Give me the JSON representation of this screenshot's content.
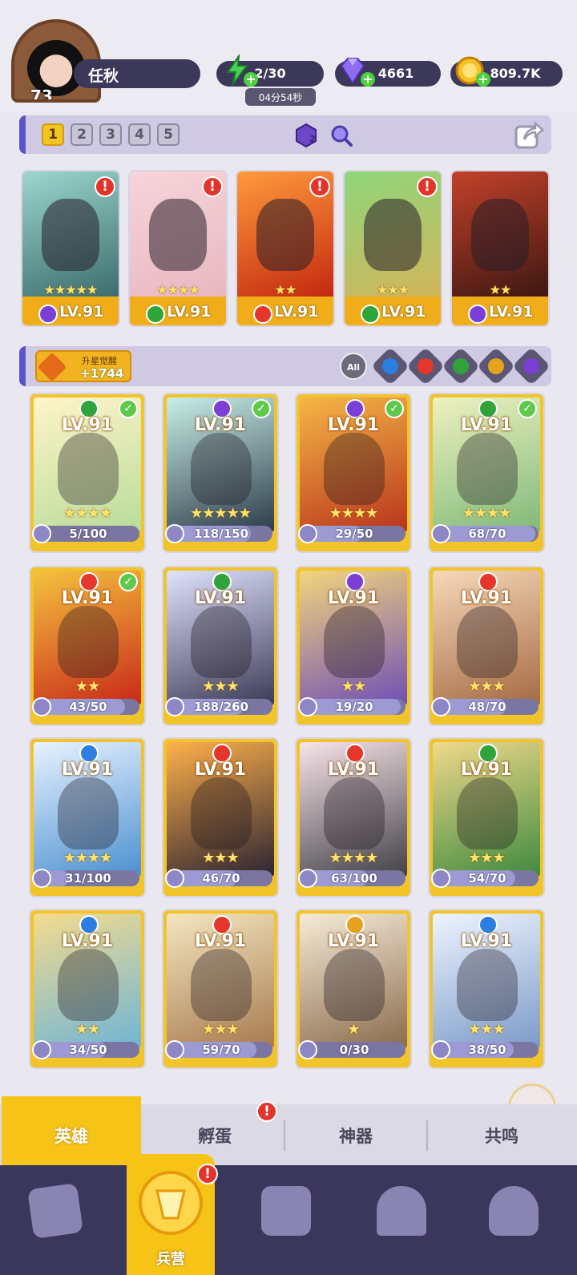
{
  "player": {
    "level": "73",
    "name": "任秋"
  },
  "resources": {
    "energy": {
      "value": "2/30",
      "timer": "04分54秒",
      "icon": "energy-icon"
    },
    "gems": {
      "value": "4661",
      "icon": "gem-icon"
    },
    "coins": {
      "value": "809.7K",
      "icon": "coin-icon"
    }
  },
  "team": {
    "tabs": [
      "1",
      "2",
      "3",
      "4",
      "5"
    ],
    "active_tab": "1",
    "badge_count": "2"
  },
  "lineup": [
    {
      "level": "LV.91",
      "stars": "★★★★★",
      "element": "dark",
      "alert": "!"
    },
    {
      "level": "LV.91",
      "stars": "★★★★",
      "element": "nature",
      "alert": "!"
    },
    {
      "level": "LV.91",
      "stars": "★★",
      "element": "fire",
      "alert": "!"
    },
    {
      "level": "LV.91",
      "stars": "★★★",
      "element": "nature",
      "alert": "!"
    },
    {
      "level": "LV.91",
      "stars": "★★",
      "element": "dark",
      "alert": ""
    }
  ],
  "awaken": {
    "label": "升星觉醒",
    "value": "+1744"
  },
  "filters": {
    "all_label": "All"
  },
  "heroes": [
    {
      "level": "LV.91",
      "stars": "★★★★",
      "shards": "5/100",
      "shard_fraction": 0.05,
      "element": "nature",
      "checked": true
    },
    {
      "level": "LV.91",
      "stars": "★★★★★",
      "shards": "118/150",
      "shard_fraction": 0.787,
      "element": "dark",
      "checked": true
    },
    {
      "level": "LV.91",
      "stars": "★★★★",
      "shards": "29/50",
      "shard_fraction": 0.58,
      "element": "dark",
      "checked": true
    },
    {
      "level": "LV.91",
      "stars": "★★★★",
      "shards": "68/70",
      "shard_fraction": 0.971,
      "element": "nature",
      "checked": true
    },
    {
      "level": "LV.91",
      "stars": "★★",
      "shards": "43/50",
      "shard_fraction": 0.86,
      "element": "fire",
      "checked": true
    },
    {
      "level": "LV.91",
      "stars": "★★★",
      "shards": "188/260",
      "shard_fraction": 0.723,
      "element": "nature",
      "checked": false
    },
    {
      "level": "LV.91",
      "stars": "★★",
      "shards": "19/20",
      "shard_fraction": 0.95,
      "element": "dark",
      "checked": false
    },
    {
      "level": "LV.91",
      "stars": "★★★",
      "shards": "48/70",
      "shard_fraction": 0.686,
      "element": "fire",
      "checked": false
    },
    {
      "level": "LV.91",
      "stars": "★★★★",
      "shards": "31/100",
      "shard_fraction": 0.31,
      "element": "water",
      "checked": false
    },
    {
      "level": "LV.91",
      "stars": "★★★",
      "shards": "46/70",
      "shard_fraction": 0.657,
      "element": "fire",
      "checked": false
    },
    {
      "level": "LV.91",
      "stars": "★★★★",
      "shards": "63/100",
      "shard_fraction": 0.63,
      "element": "fire",
      "checked": false
    },
    {
      "level": "LV.91",
      "stars": "★★★",
      "shards": "54/70",
      "shard_fraction": 0.771,
      "element": "nature",
      "checked": false
    },
    {
      "level": "LV.91",
      "stars": "★★",
      "shards": "34/50",
      "shard_fraction": 0.68,
      "element": "water",
      "checked": false
    },
    {
      "level": "LV.91",
      "stars": "★★★",
      "shards": "59/70",
      "shard_fraction": 0.843,
      "element": "fire",
      "checked": false
    },
    {
      "level": "LV.91",
      "stars": "★",
      "shards": "0/30",
      "shard_fraction": 0.0,
      "element": "light",
      "checked": false
    },
    {
      "level": "LV.91",
      "stars": "★★★",
      "shards": "38/50",
      "shard_fraction": 0.76,
      "element": "water",
      "checked": false
    }
  ],
  "bottom_tabs": [
    {
      "label": "英雄",
      "active": true,
      "alert": false
    },
    {
      "label": "孵蛋",
      "active": false,
      "alert": true
    },
    {
      "label": "神器",
      "active": false,
      "alert": false
    },
    {
      "label": "共鸣",
      "active": false,
      "alert": false
    }
  ],
  "nav": {
    "active_label": "兵营"
  },
  "colors": {
    "fire": "#e4362a",
    "water": "#2c7fe0",
    "nature": "#2fa43b",
    "light": "#e6a21c",
    "dark": "#7b3fd6",
    "accent": "#f6c417",
    "panel": "#3c3859"
  },
  "art_gradients": [
    "linear-gradient(160deg,#9bd6cf,#3a6b6a)",
    "linear-gradient(160deg,#f7d4da,#e8b7c1)",
    "linear-gradient(160deg,#ff9a3c,#c2270f)",
    "linear-gradient(160deg,#8fd67a,#d3b45a)",
    "linear-gradient(160deg,#c3412a,#3b1711)"
  ],
  "hero_gradients": [
    "linear-gradient(160deg,#fff4c9,#b8dc9a)",
    "linear-gradient(160deg,#c8efe8,#2c3b49)",
    "linear-gradient(160deg,#f6b645,#b8341d)",
    "linear-gradient(160deg,#eef1c0,#7fb978)",
    "linear-gradient(160deg,#f5c23e,#c82819)",
    "linear-gradient(160deg,#dfe3ff,#3c3a55)",
    "linear-gradient(160deg,#f3d57d,#6f4fb4)",
    "linear-gradient(160deg,#f6d8b8,#a56a44)",
    "linear-gradient(160deg,#e8f3ff,#4a8fd0)",
    "linear-gradient(160deg,#ffb04a,#2b2432)",
    "linear-gradient(160deg,#f7e4e8,#414047)",
    "linear-gradient(160deg,#f0d98a,#3f8a3e)",
    "linear-gradient(160deg,#f4db8e,#6fb5d6)",
    "linear-gradient(160deg,#f4e6c0,#a77a4f)",
    "linear-gradient(160deg,#f7ebd7,#8a6b4d)",
    "linear-gradient(160deg,#eef4ff,#7b9ac8)"
  ]
}
